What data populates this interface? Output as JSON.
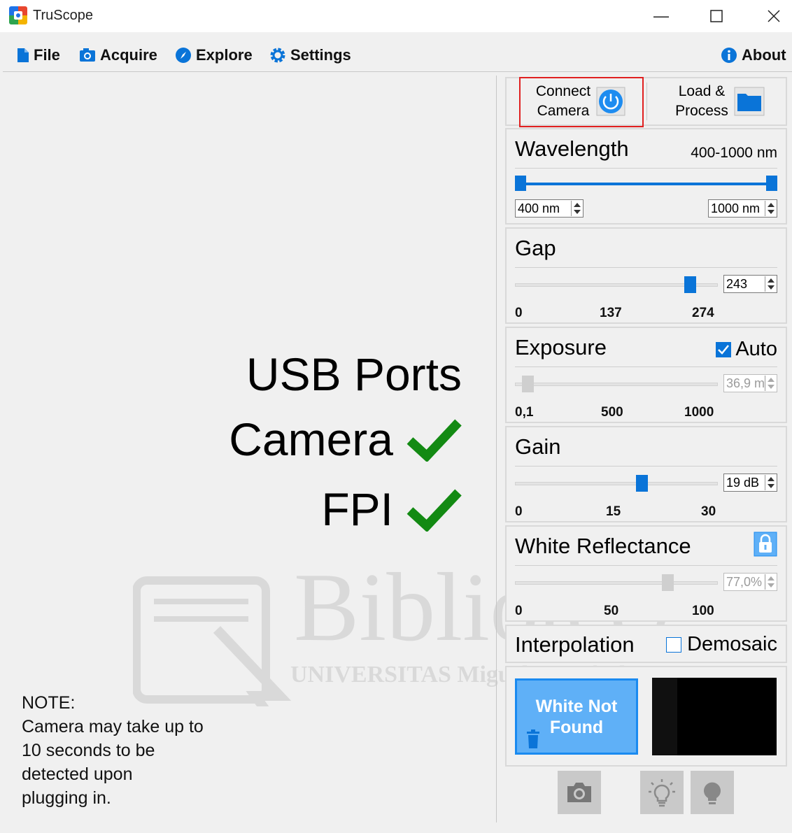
{
  "window": {
    "title": "TruScope",
    "minimize": "—",
    "maximize": "☐",
    "close": "✕"
  },
  "menu": {
    "file": "File",
    "acquire": "Acquire",
    "explore": "Explore",
    "settings": "Settings",
    "about": "About"
  },
  "status": {
    "usb_ports": "USB Ports",
    "camera": "Camera",
    "fpi": "FPI",
    "check_color": "#138a13"
  },
  "note": "NOTE:\nCamera may take up to\n10 seconds to be\ndetected upon\nplugging in.",
  "toolbar": {
    "connect_camera": "Connect\nCamera",
    "load_process": "Load &\nProcess",
    "highlight_color": "#e02020"
  },
  "wavelength": {
    "title": "Wavelength",
    "range_label": "400-1000 nm",
    "min_value": "400 nm",
    "max_value": "1000 nm",
    "range_low_fraction": 0,
    "range_high_fraction": 1
  },
  "gap": {
    "title": "Gap",
    "value": "243",
    "ticks": [
      "0",
      "137",
      "274"
    ],
    "value_fraction": 0.887
  },
  "exposure": {
    "title": "Exposure",
    "auto_label": "Auto",
    "auto_checked": true,
    "value": "36,9 m",
    "ticks": [
      "0,1",
      "500",
      "1000"
    ],
    "value_fraction": 0.037
  },
  "gain": {
    "title": "Gain",
    "value": "19 dB",
    "ticks": [
      "0",
      "15",
      "30"
    ],
    "value_fraction": 0.633
  },
  "white_reflectance": {
    "title": "White Reflectance",
    "value": "77,0%",
    "ticks": [
      "0",
      "50",
      "100"
    ],
    "value_fraction": 0.77
  },
  "interpolation": {
    "title": "Interpolation",
    "demosaic_label": "Demosaic",
    "demosaic_checked": false
  },
  "white_button": {
    "label": "White Not\nFound"
  },
  "accent_color": "#0a74d8"
}
